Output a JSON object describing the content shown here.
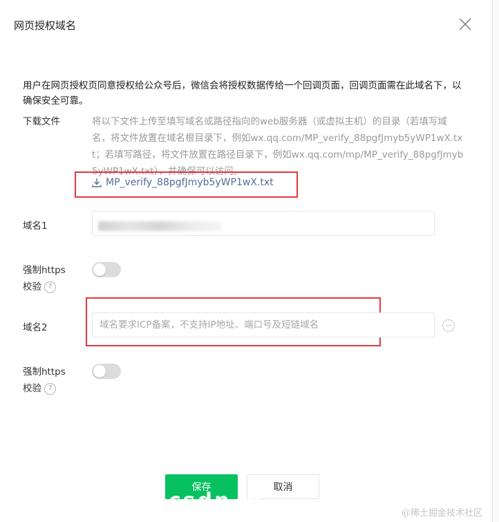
{
  "dialog": {
    "title": "网页授权域名",
    "intro": "用户在网页授权页同意授权给公众号后，微信会将授权数据传给一个回调页面，回调页面需在此域名下，以确保安全可靠。"
  },
  "download": {
    "label": "下载文件",
    "help": "将以下文件上传至填写域名或路径指向的web服务器（或虚拟主机）的目录（若填写域名，将文件放置在域名根目录下，例如wx.qq.com/MP_verify_88pgfJmyb5yWP1wX.txt；若填写路径，将文件放置在路径目录下，例如wx.qq.com/mp/MP_verify_88pgfJmyb5yWP1wX.txt），并确保可以访问。",
    "file_name": "MP_verify_88pgfJmyb5yWP1wX.txt"
  },
  "domain1": {
    "label": "域名1",
    "value": ""
  },
  "https1": {
    "label_line1": "强制https",
    "label_line2": "校验",
    "enabled": false
  },
  "domain2": {
    "label": "域名2",
    "placeholder": "域名要求ICP备案，不支持IP地址、端口号及短链域名",
    "value": ""
  },
  "https2": {
    "label_line1": "强制https",
    "label_line2": "校验",
    "enabled": false
  },
  "buttons": {
    "save": "保存",
    "cancel": "取消"
  },
  "overlay": {
    "text": "csdn.w...."
  },
  "watermark": "@稀土掘金技术社区",
  "colors": {
    "primary": "#07c160",
    "link": "#576b95",
    "highlight": "#e0383e"
  }
}
